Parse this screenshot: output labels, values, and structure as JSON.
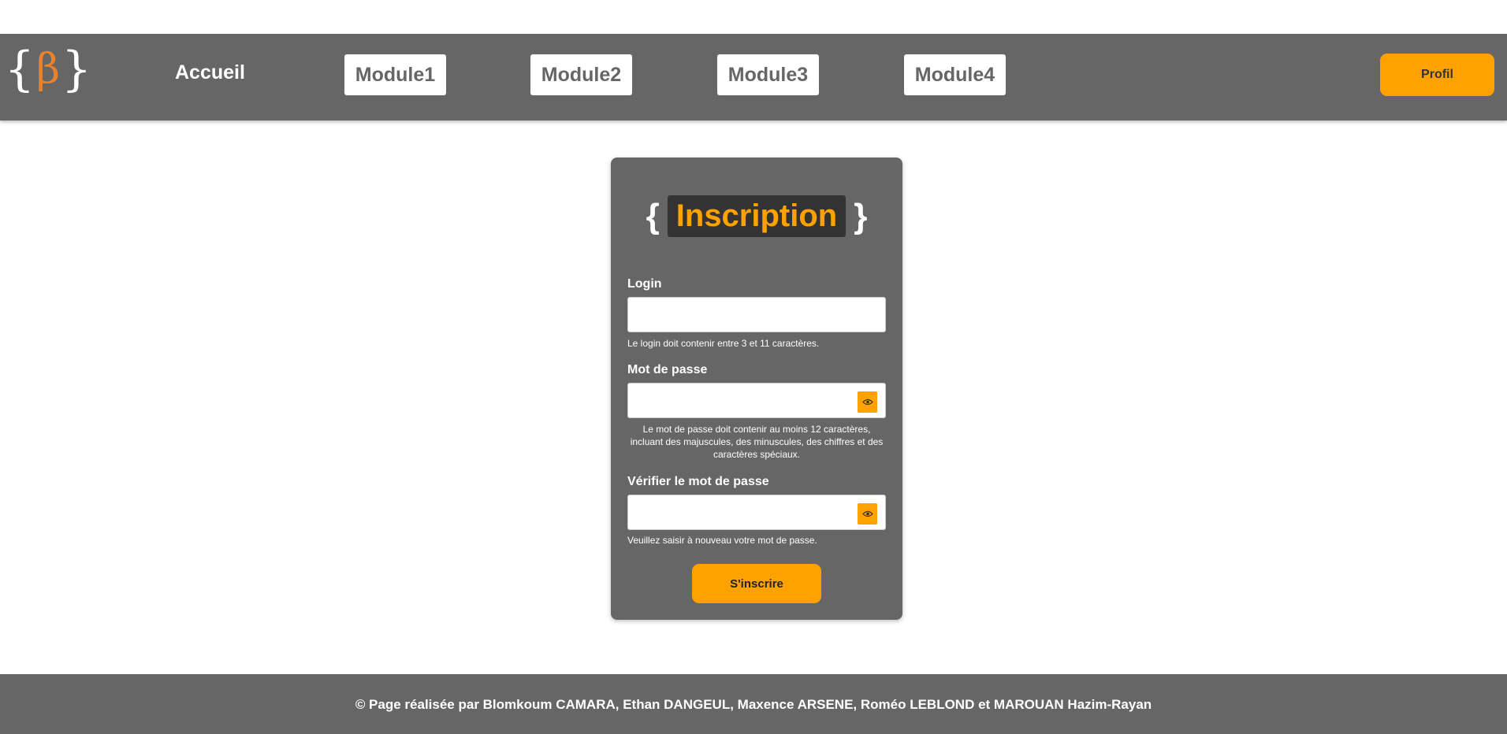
{
  "colors": {
    "nav_background": "#666666",
    "accent": "#ffa200",
    "logo_beta": "#e8822d",
    "title_box": "#333333",
    "page_background": "#ffffff"
  },
  "nav": {
    "logo": {
      "left_brace": "{",
      "beta": "β",
      "right_brace": "}"
    },
    "home_label": "Accueil",
    "modules": [
      "Module1",
      "Module2",
      "Module3",
      "Module4"
    ],
    "profile_label": "Profil"
  },
  "form": {
    "title_left_brace": "{",
    "title": "Inscription",
    "title_right_brace": "}",
    "login": {
      "label": "Login",
      "value": "",
      "hint": "Le login doit contenir entre 3 et 11 caractères."
    },
    "password": {
      "label": "Mot de passe",
      "value": "",
      "hint": "Le mot de passe doit contenir au moins 12 caractères, incluant des majuscules, des minuscules, des chiffres et des caractères spéciaux.",
      "toggle_icon": "eye-icon"
    },
    "confirm_password": {
      "label": "Vérifier le mot de passe",
      "value": "",
      "hint": "Veuillez saisir à nouveau votre mot de passe.",
      "toggle_icon": "eye-icon"
    },
    "submit_label": "S'inscrire"
  },
  "footer": {
    "text": "© Page réalisée par Blomkoum CAMARA, Ethan DANGEUL, Maxence ARSENE, Roméo LEBLOND et MAROUAN Hazim-Rayan"
  }
}
